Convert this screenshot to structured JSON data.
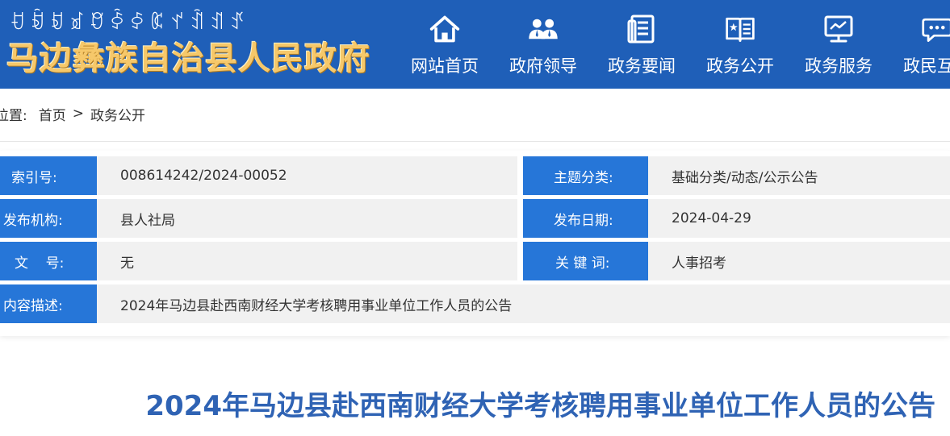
{
  "header": {
    "yi_script": "ꀀꀁꀂꀃꀄꀅꀆꀇꀈꀉꀊꀋ",
    "site_name": "马边彝族自治县人民政府",
    "nav": [
      {
        "label": "网站首页",
        "icon": "home-icon"
      },
      {
        "label": "政府领导",
        "icon": "leaders-icon"
      },
      {
        "label": "政务要闻",
        "icon": "news-icon"
      },
      {
        "label": "政务公开",
        "icon": "open-book-icon"
      },
      {
        "label": "政务服务",
        "icon": "monitor-icon"
      },
      {
        "label": "政民互动",
        "icon": "chat-icon"
      }
    ]
  },
  "breadcrumb": {
    "prefix": "位置:",
    "home": "首页",
    "separator": ">",
    "current": "政务公开"
  },
  "info": {
    "index_label": "索引号:",
    "index_value": "008614242/2024-00052",
    "topic_label": "主题分类:",
    "topic_value": "基础分类/动态/公示公告",
    "publisher_label": "发布机构:",
    "publisher_value": "县人社局",
    "date_label": "发布日期:",
    "date_value": "2024-04-29",
    "docno_label": "文    号:",
    "docno_value": "无",
    "keywords_label": "关 键 词:",
    "keywords_value": "人事招考",
    "desc_label": "内容描述:",
    "desc_value": "2024年马边县赴西南财经大学考核聘用事业单位工作人员的公告"
  },
  "article": {
    "title": "2024年马边县赴西南财经大学考核聘用事业单位工作人员的公告"
  },
  "colors": {
    "header_bg": "#1f5fb8",
    "label_bg": "#2676d8",
    "value_bg": "#f1f1f1",
    "title_color": "#2f63b4",
    "site_name_color": "#f6c86a"
  }
}
